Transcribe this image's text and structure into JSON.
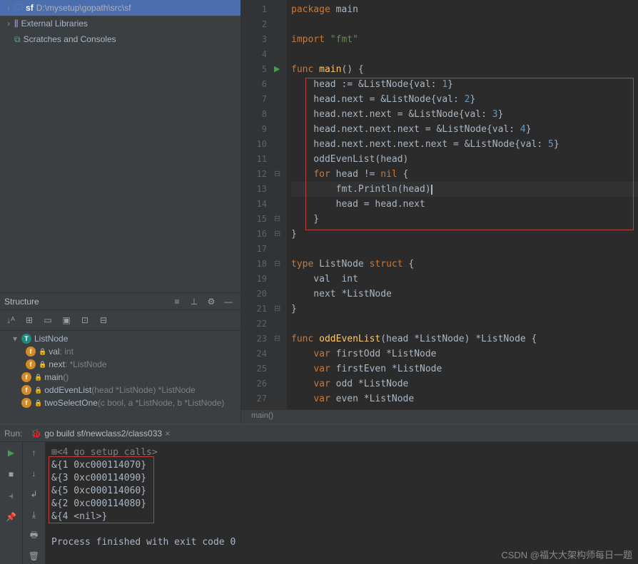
{
  "project": {
    "root": "sf",
    "root_path": "D:\\mysetup\\gopath\\src\\sf",
    "ext_libs": "External Libraries",
    "scratches": "Scratches and Consoles"
  },
  "structure": {
    "title": "Structure",
    "items": [
      {
        "type": "t",
        "label": "ListNode",
        "depth": 1,
        "arrow": "▾"
      },
      {
        "type": "f",
        "label": "val",
        "detail": ": int",
        "depth": 2,
        "lock": true
      },
      {
        "type": "f",
        "label": "next",
        "detail": ": *ListNode",
        "depth": 2,
        "lock": true
      },
      {
        "type": "f",
        "label": "main",
        "detail": "()",
        "depth": 1,
        "lock": true
      },
      {
        "type": "f",
        "label": "oddEvenList",
        "detail": "(head *ListNode) *ListNode",
        "depth": 1,
        "lock": true
      },
      {
        "type": "f",
        "label": "twoSelectOne",
        "detail": "(c bool, a *ListNode, b *ListNode)",
        "depth": 1,
        "lock": true
      }
    ]
  },
  "editor": {
    "crumb": "main()",
    "lines": [
      {
        "n": 1,
        "tokens": [
          {
            "c": "c-key",
            "t": "package "
          },
          {
            "c": "c-pkg",
            "t": "main"
          }
        ]
      },
      {
        "n": 2,
        "tokens": []
      },
      {
        "n": 3,
        "tokens": [
          {
            "c": "c-key",
            "t": "import "
          },
          {
            "c": "c-str",
            "t": "\"fmt\""
          }
        ]
      },
      {
        "n": 4,
        "tokens": []
      },
      {
        "n": 5,
        "tokens": [
          {
            "c": "c-key",
            "t": "func "
          },
          {
            "c": "c-func-def",
            "t": "main"
          },
          {
            "c": "c-ident",
            "t": "() {"
          }
        ],
        "run": true,
        "fold": "⊟"
      },
      {
        "n": 6,
        "tokens": [
          {
            "c": "c-ident",
            "t": "    head := &ListNode{val: "
          },
          {
            "c": "c-num",
            "t": "1"
          },
          {
            "c": "c-ident",
            "t": "}"
          }
        ]
      },
      {
        "n": 7,
        "tokens": [
          {
            "c": "c-ident",
            "t": "    head.next = &ListNode{val: "
          },
          {
            "c": "c-num",
            "t": "2"
          },
          {
            "c": "c-ident",
            "t": "}"
          }
        ]
      },
      {
        "n": 8,
        "tokens": [
          {
            "c": "c-ident",
            "t": "    head.next.next = &ListNode{val: "
          },
          {
            "c": "c-num",
            "t": "3"
          },
          {
            "c": "c-ident",
            "t": "}"
          }
        ]
      },
      {
        "n": 9,
        "tokens": [
          {
            "c": "c-ident",
            "t": "    head.next.next.next = &ListNode{val: "
          },
          {
            "c": "c-num",
            "t": "4"
          },
          {
            "c": "c-ident",
            "t": "}"
          }
        ]
      },
      {
        "n": 10,
        "tokens": [
          {
            "c": "c-ident",
            "t": "    head.next.next.next.next = &ListNode{val: "
          },
          {
            "c": "c-num",
            "t": "5"
          },
          {
            "c": "c-ident",
            "t": "}"
          }
        ]
      },
      {
        "n": 11,
        "tokens": [
          {
            "c": "c-ident",
            "t": "    oddEvenList(head)"
          }
        ]
      },
      {
        "n": 12,
        "tokens": [
          {
            "c": "c-ident",
            "t": "    "
          },
          {
            "c": "c-key",
            "t": "for "
          },
          {
            "c": "c-ident",
            "t": "head != "
          },
          {
            "c": "c-key",
            "t": "nil"
          },
          {
            "c": "c-ident",
            "t": " {"
          }
        ],
        "fold": "⊟"
      },
      {
        "n": 13,
        "tokens": [
          {
            "c": "c-ident",
            "t": "        fmt.Println(head)"
          }
        ],
        "cur": true,
        "caret": true
      },
      {
        "n": 14,
        "tokens": [
          {
            "c": "c-ident",
            "t": "        head = head.next"
          }
        ]
      },
      {
        "n": 15,
        "tokens": [
          {
            "c": "c-ident",
            "t": "    }"
          }
        ],
        "fold": "⊟"
      },
      {
        "n": 16,
        "tokens": [
          {
            "c": "c-ident",
            "t": "}"
          }
        ],
        "fold": "⊟"
      },
      {
        "n": 17,
        "tokens": []
      },
      {
        "n": 18,
        "tokens": [
          {
            "c": "c-key",
            "t": "type "
          },
          {
            "c": "c-ident",
            "t": "ListNode "
          },
          {
            "c": "c-key",
            "t": "struct"
          },
          {
            "c": "c-ident",
            "t": " {"
          }
        ],
        "fold": "⊟"
      },
      {
        "n": 19,
        "tokens": [
          {
            "c": "c-ident",
            "t": "    val  "
          },
          {
            "c": "c-type",
            "t": "int"
          }
        ]
      },
      {
        "n": 20,
        "tokens": [
          {
            "c": "c-ident",
            "t": "    next *ListNode"
          }
        ]
      },
      {
        "n": 21,
        "tokens": [
          {
            "c": "c-ident",
            "t": "}"
          }
        ],
        "fold": "⊟"
      },
      {
        "n": 22,
        "tokens": []
      },
      {
        "n": 23,
        "tokens": [
          {
            "c": "c-key",
            "t": "func "
          },
          {
            "c": "c-func-def",
            "t": "oddEvenList"
          },
          {
            "c": "c-ident",
            "t": "(head *ListNode) *ListNode {"
          }
        ],
        "fold": "⊟"
      },
      {
        "n": 24,
        "tokens": [
          {
            "c": "c-ident",
            "t": "    "
          },
          {
            "c": "c-key",
            "t": "var "
          },
          {
            "c": "c-ident",
            "t": "firstOdd *ListNode"
          }
        ]
      },
      {
        "n": 25,
        "tokens": [
          {
            "c": "c-ident",
            "t": "    "
          },
          {
            "c": "c-key",
            "t": "var "
          },
          {
            "c": "c-ident",
            "t": "firstEven *ListNode"
          }
        ]
      },
      {
        "n": 26,
        "tokens": [
          {
            "c": "c-ident",
            "t": "    "
          },
          {
            "c": "c-key",
            "t": "var "
          },
          {
            "c": "c-ident",
            "t": "odd *ListNode"
          }
        ]
      },
      {
        "n": 27,
        "tokens": [
          {
            "c": "c-ident",
            "t": "    "
          },
          {
            "c": "c-key",
            "t": "var "
          },
          {
            "c": "c-ident",
            "t": "even *ListNode"
          }
        ]
      }
    ]
  },
  "run": {
    "label": "Run:",
    "tab": "go build sf/newclass2/class033",
    "lines": [
      {
        "c": "gray",
        "t": "⊞<4 go setup calls>"
      },
      {
        "c": "",
        "t": "&{1 0xc000114070}"
      },
      {
        "c": "",
        "t": "&{3 0xc000114090}"
      },
      {
        "c": "",
        "t": "&{5 0xc000114060}"
      },
      {
        "c": "",
        "t": "&{2 0xc000114080}"
      },
      {
        "c": "",
        "t": "&{4 <nil>}"
      },
      {
        "c": "",
        "t": ""
      },
      {
        "c": "",
        "t": "Process finished with exit code 0"
      }
    ]
  },
  "watermark": "CSDN @福大大架构师每日一题"
}
